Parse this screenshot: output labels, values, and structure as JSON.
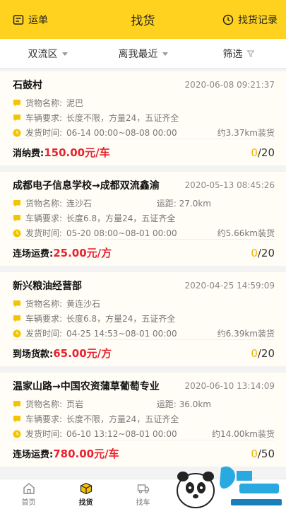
{
  "header": {
    "left_label": "运单",
    "title": "找货",
    "right_label": "找货记录"
  },
  "filters": [
    {
      "label": "双流区"
    },
    {
      "label": "离我最近"
    },
    {
      "label": "筛选"
    }
  ],
  "cards": [
    {
      "title": "石鼓村",
      "time": "2020-06-08 09:21:37",
      "goods_label": "货物名称:",
      "goods": "泥巴",
      "distance": "",
      "vehicle_label": "车辆要求:",
      "vehicle": "长度不限，方量24，五证齐全",
      "ship_label": "发货时间:",
      "ship": "06-14 00:00~08-08 00:00",
      "pickup": "约3.37km装货",
      "fee_label": "消纳费:",
      "fee": "150.00元/车",
      "count_cur": "0",
      "count_total": "/20"
    },
    {
      "title": "成都电子信息学校→成都双流鑫渝",
      "time": "2020-05-13 08:45:26",
      "goods_label": "货物名称:",
      "goods": "连沙石",
      "distance": "运距: 27.0km",
      "vehicle_label": "车辆要求:",
      "vehicle": "长度6.8，方量24，五证齐全",
      "ship_label": "发货时间:",
      "ship": "05-20 08:00~08-01 00:00",
      "pickup": "约5.66km装货",
      "fee_label": "连场运费:",
      "fee": "25.00元/方",
      "count_cur": "0",
      "count_total": "/20"
    },
    {
      "title": "新兴粮油经营部",
      "time": "2020-04-25 14:59:09",
      "goods_label": "货物名称:",
      "goods": "黄连沙石",
      "distance": "",
      "vehicle_label": "车辆要求:",
      "vehicle": "长度6.8，方量24，五证齐全",
      "ship_label": "发货时间:",
      "ship": "04-25 14:53~08-01 00:00",
      "pickup": "约6.39km装货",
      "fee_label": "到场货款:",
      "fee": "65.00元/方",
      "count_cur": "0",
      "count_total": "/20"
    },
    {
      "title": "温家山路→中国农资蒲草葡萄专业",
      "time": "2020-06-10 13:14:09",
      "goods_label": "货物名称:",
      "goods": "页岩",
      "distance": "运距: 36.0km",
      "vehicle_label": "车辆要求:",
      "vehicle": "长度不限，方量24，五证齐全",
      "ship_label": "发货时间:",
      "ship": "06-10 13:12~08-01 00:00",
      "pickup": "约14.00km装货",
      "fee_label": "连场运费:",
      "fee": "780.00元/车",
      "count_cur": "0",
      "count_total": "/50"
    }
  ],
  "tabbar": [
    {
      "label": "首页",
      "icon": "home-icon"
    },
    {
      "label": "找货",
      "icon": "box-icon"
    },
    {
      "label": "找车",
      "icon": "truck-icon"
    }
  ],
  "colors": {
    "brand": "#ffd21f",
    "price": "#e8232f",
    "count_current": "#f0b400"
  }
}
